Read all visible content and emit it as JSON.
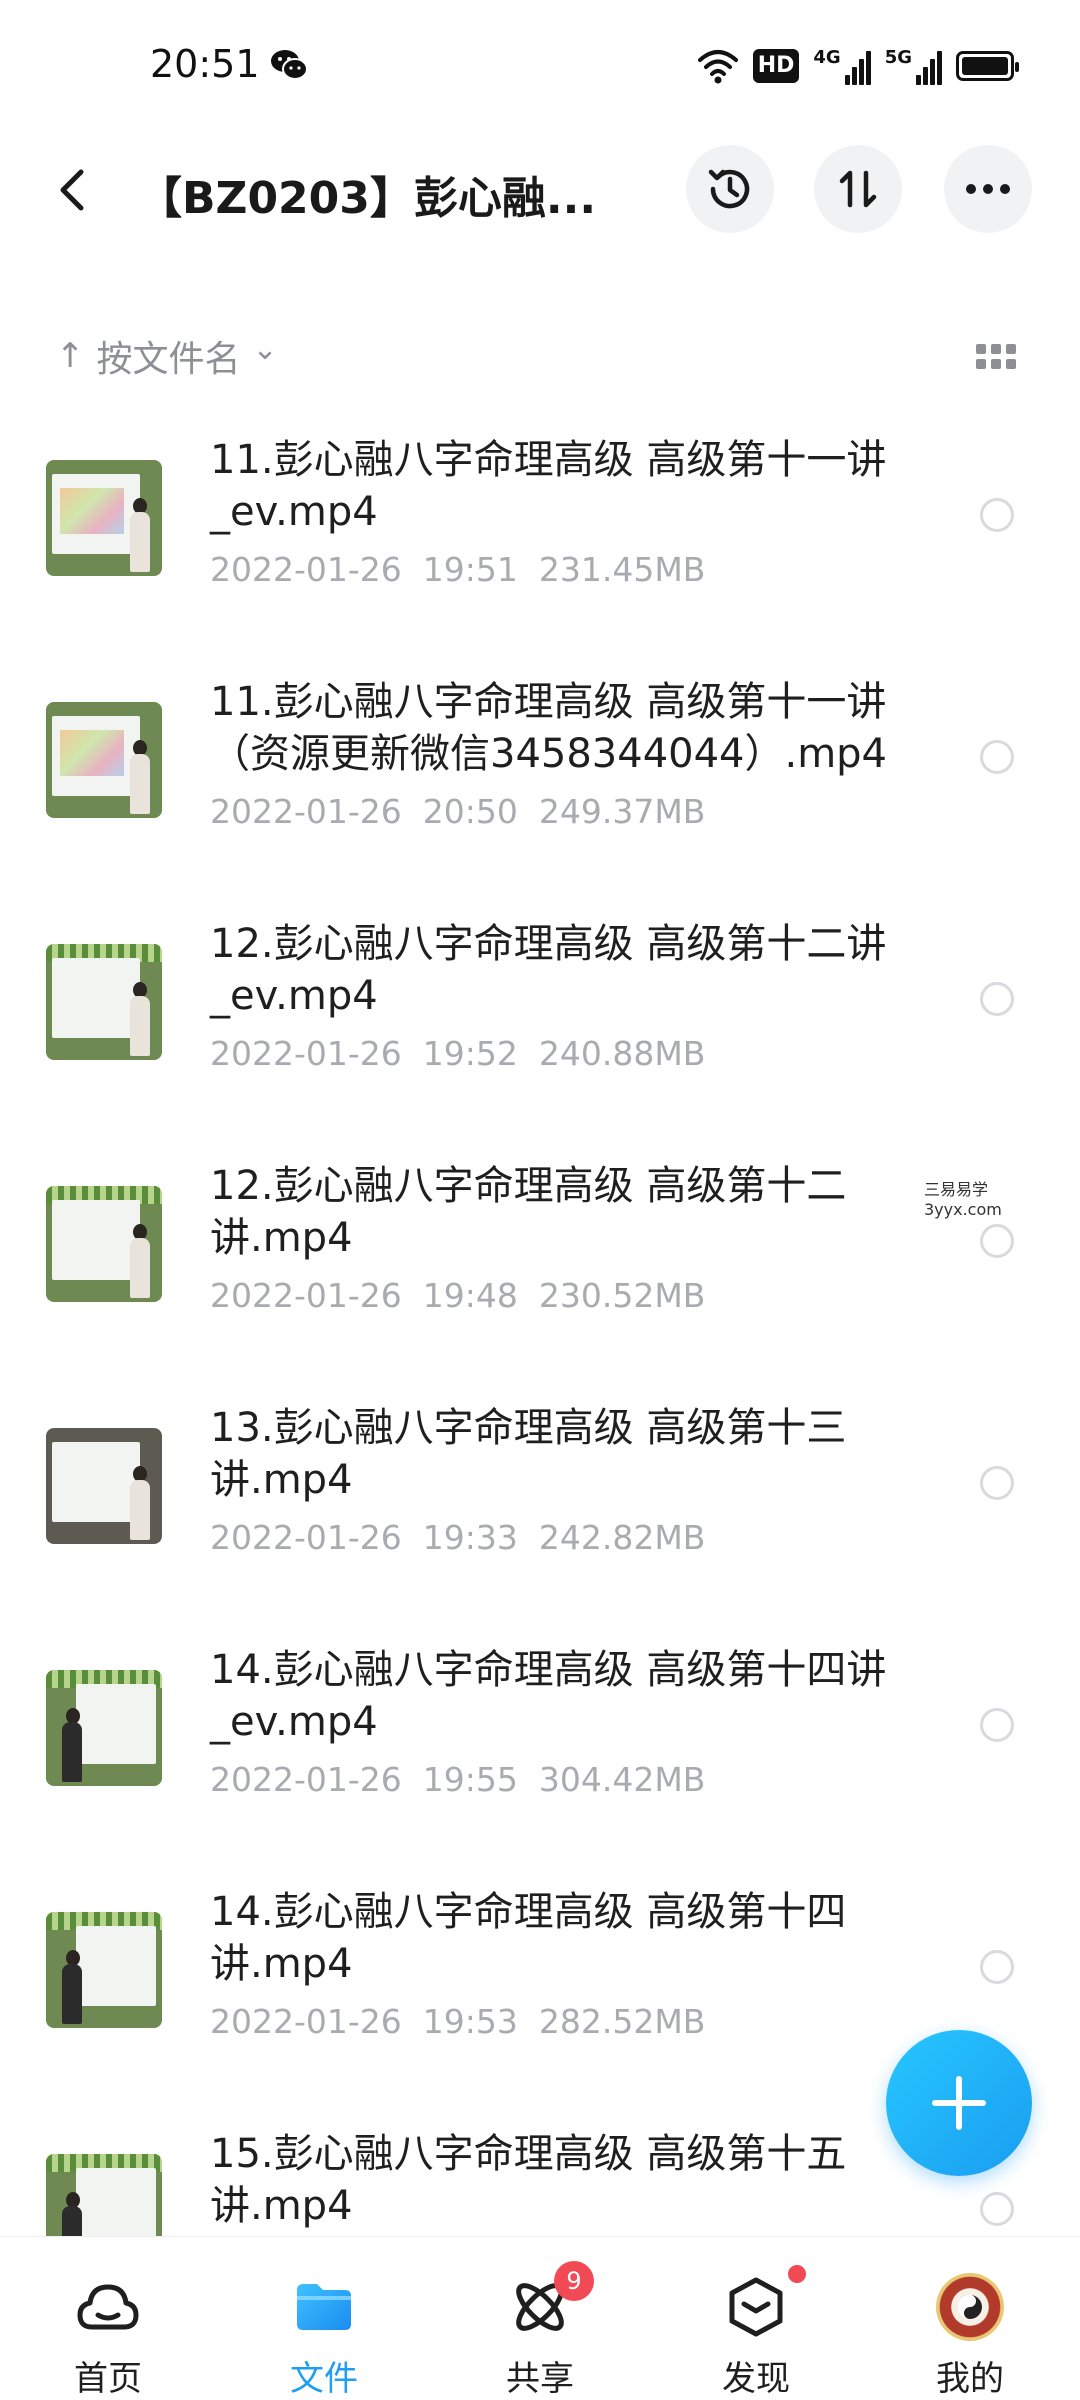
{
  "status_bar": {
    "time": "20:51",
    "hd_badge": "HD",
    "network_1": "4G",
    "network_2": "5G",
    "icons": [
      "wechat-icon",
      "wifi-icon",
      "signal-icon",
      "battery-icon"
    ]
  },
  "header": {
    "title": "【BZ0203】彭心融...",
    "icons": [
      "back-arrow-icon",
      "history-icon",
      "sort-icon",
      "more-icon"
    ]
  },
  "sort": {
    "label": "按文件名",
    "arrow": "↑",
    "chevron": "⌄"
  },
  "files": [
    {
      "name": "11.彭心融八字命理高级 高级第十一讲_ev.mp4",
      "date": "2022-01-26",
      "time": "19:51",
      "size": "231.45MB"
    },
    {
      "name": "11.彭心融八字命理高级 高级第十一讲（资源更新微信3458344044）.mp4",
      "date": "2022-01-26",
      "time": "20:50",
      "size": "249.37MB"
    },
    {
      "name": "12.彭心融八字命理高级 高级第十二讲_ev.mp4",
      "date": "2022-01-26",
      "time": "19:52",
      "size": "240.88MB"
    },
    {
      "name": "12.彭心融八字命理高级 高级第十二讲.mp4",
      "date": "2022-01-26",
      "time": "19:48",
      "size": "230.52MB"
    },
    {
      "name": "13.彭心融八字命理高级 高级第十三讲.mp4",
      "date": "2022-01-26",
      "time": "19:33",
      "size": "242.82MB"
    },
    {
      "name": "14.彭心融八字命理高级 高级第十四讲_ev.mp4",
      "date": "2022-01-26",
      "time": "19:55",
      "size": "304.42MB"
    },
    {
      "name": "14.彭心融八字命理高级 高级第十四讲.mp4",
      "date": "2022-01-26",
      "time": "19:53",
      "size": "282.52MB"
    },
    {
      "name": "15.彭心融八字命理高级 高级第十五讲.mp4",
      "date": "",
      "time": "",
      "size": ""
    }
  ],
  "watermark": {
    "line1": "三易易学",
    "line2": "3yyx.com"
  },
  "fab": {
    "icon": "plus-icon"
  },
  "bottom_nav": {
    "tabs": [
      {
        "label": "首页",
        "icon": "cloud-home-icon",
        "active": false
      },
      {
        "label": "文件",
        "icon": "folder-icon",
        "active": true
      },
      {
        "label": "共享",
        "icon": "atom-share-icon",
        "badge": "9",
        "active": false
      },
      {
        "label": "发现",
        "icon": "cube-discover-icon",
        "dot": true,
        "active": false
      },
      {
        "label": "我的",
        "icon": "avatar",
        "active": false
      }
    ],
    "active_color": "#1e9ff2",
    "badge_color": "#f24a55"
  }
}
